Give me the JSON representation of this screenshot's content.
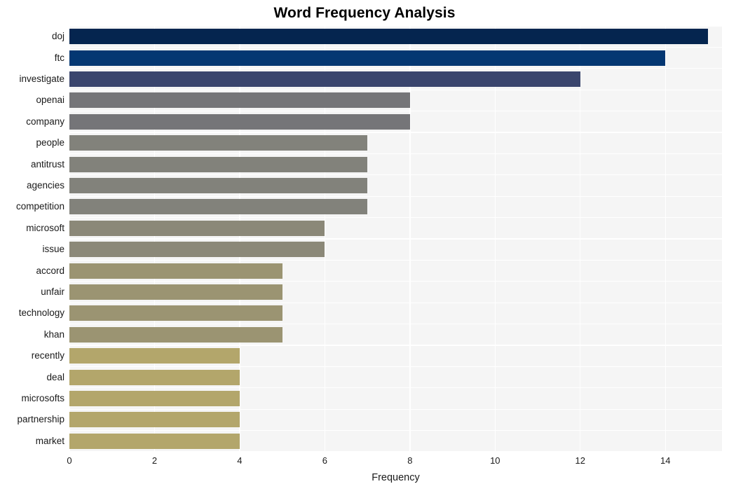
{
  "chart_data": {
    "type": "bar",
    "orientation": "horizontal",
    "title": "Word Frequency Analysis",
    "xlabel": "Frequency",
    "ylabel": "",
    "categories": [
      "doj",
      "ftc",
      "investigate",
      "openai",
      "company",
      "people",
      "antitrust",
      "agencies",
      "competition",
      "microsoft",
      "issue",
      "accord",
      "unfair",
      "technology",
      "khan",
      "recently",
      "deal",
      "microsofts",
      "partnership",
      "market"
    ],
    "values": [
      15,
      14,
      12,
      8,
      8,
      7,
      7,
      7,
      7,
      6,
      6,
      5,
      5,
      5,
      5,
      4,
      4,
      4,
      4,
      4
    ],
    "bar_colors": [
      "#05254f",
      "#043772",
      "#3a456d",
      "#757578",
      "#757578",
      "#82827b",
      "#82827b",
      "#82827b",
      "#82827b",
      "#8b8878",
      "#8b8878",
      "#9b9472",
      "#9b9472",
      "#9b9472",
      "#9b9472",
      "#b3a66b",
      "#b3a66b",
      "#b3a66b",
      "#b3a66b",
      "#b3a66b"
    ],
    "xlim": [
      0,
      15.33
    ],
    "xticks": [
      0,
      2,
      4,
      6,
      8,
      10,
      12,
      14
    ],
    "xtick_labels": [
      "0",
      "2",
      "4",
      "6",
      "8",
      "10",
      "12",
      "14"
    ],
    "grid": true,
    "grid_color": "#ffffff",
    "legend": null,
    "plot_background": "#f5f5f5",
    "figure_background": "#ffffff",
    "title_color": "#000000",
    "tick_label_color": "#1a1a1a"
  }
}
